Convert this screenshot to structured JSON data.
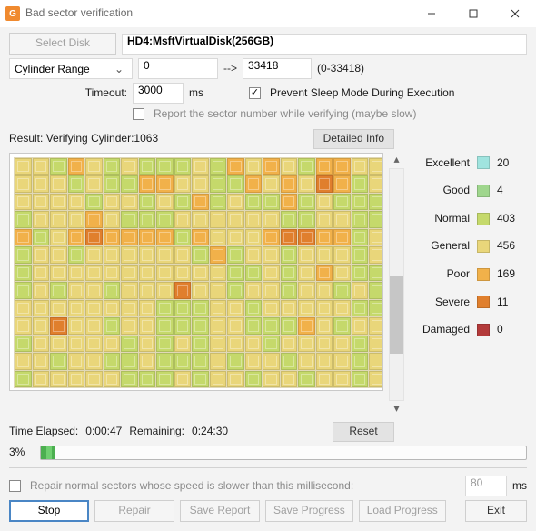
{
  "window": {
    "title": "Bad sector verification"
  },
  "toolbar": {
    "select_disk": "Select Disk",
    "disk_name": "HD4:MsftVirtualDisk(256GB)"
  },
  "range": {
    "label": "Cylinder Range",
    "from": "0",
    "to": "33418",
    "hint": "(0-33418)"
  },
  "timeout": {
    "label": "Timeout:",
    "value": "3000",
    "unit": "ms",
    "prevent_sleep": "Prevent Sleep Mode During Execution",
    "report_sector": "Report the sector number while verifying (maybe slow)"
  },
  "result": {
    "label": "Result:",
    "status_prefix": "Verifying Cylinder:",
    "status_value": "1063",
    "detailed_btn": "Detailed Info"
  },
  "legend": {
    "items": [
      {
        "key": "exc",
        "label": "Excellent",
        "count": "20"
      },
      {
        "key": "good",
        "label": "Good",
        "count": "4"
      },
      {
        "key": "norm",
        "label": "Normal",
        "count": "403"
      },
      {
        "key": "gen",
        "label": "General",
        "count": "456"
      },
      {
        "key": "poor",
        "label": "Poor",
        "count": "169"
      },
      {
        "key": "sev",
        "label": "Severe",
        "count": "11"
      },
      {
        "key": "dmg",
        "label": "Damaged",
        "count": "0"
      }
    ]
  },
  "timing": {
    "elapsed_label": "Time Elapsed:",
    "elapsed": "0:00:47",
    "remaining_label": "Remaining:",
    "remaining": "0:24:30",
    "reset": "Reset",
    "percent": "3%"
  },
  "repair_opt": {
    "label": "Repair normal sectors whose speed is slower than this millisecond:",
    "value": "80",
    "unit": "ms"
  },
  "buttons": {
    "stop": "Stop",
    "repair": "Repair",
    "save_report": "Save Report",
    "save_progress": "Save Progress",
    "load_progress": "Load Progress",
    "exit": "Exit"
  },
  "grid_rows": [
    "ggnpgngnnngnpgpgnppgg",
    "gggngnnppggnnpgpgspng",
    "ggggnggngnpngnnpngnnn",
    "ngggpgnnnggggggnnggnn",
    "pngpsppppnpgggpssppng",
    "nggnggggggnpnggngggng",
    "ngggggggggggnngngpgnn",
    "ngnggngggsggnggnggngn",
    "ggggggggnnnggngggggnn",
    "ggsggnggnnnggnnnpgngg",
    "ngggggngngngggnggggng",
    "ggnggnngnnngnggngggng",
    "ngggggnnngnggnggnggng"
  ],
  "grid_map": {
    "e": "exc",
    "d": "good",
    "n": "norm",
    "g": "gen",
    "p": "poor",
    "s": "sev",
    "x": "dmg"
  }
}
